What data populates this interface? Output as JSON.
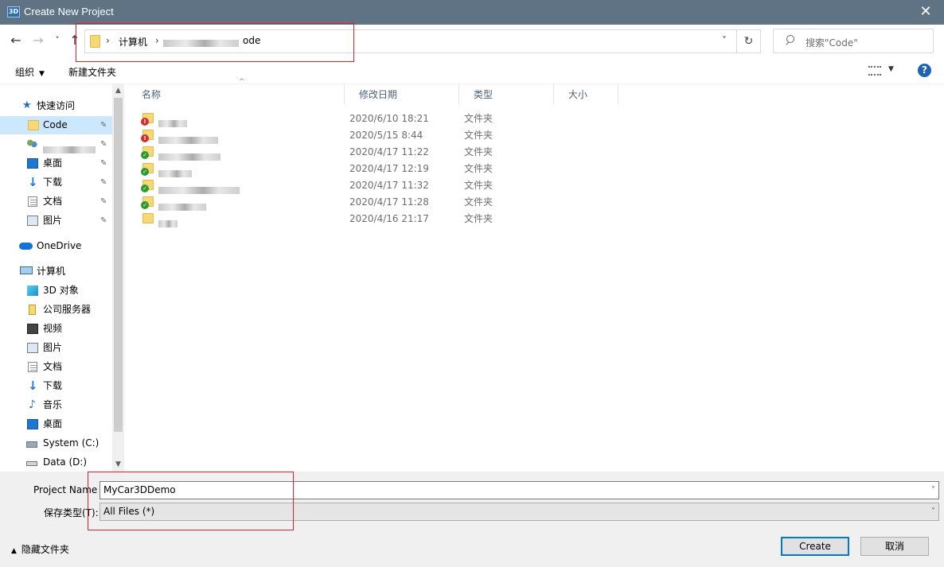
{
  "window": {
    "title": "Create New Project",
    "app_icon_text": "3D",
    "close_glyph": "✕"
  },
  "nav": {
    "back_glyph": "←",
    "forward_glyph": "→",
    "recent_glyph": "˅",
    "up_glyph": "↑"
  },
  "address": {
    "crumb_computer": "计算机",
    "crumb_last_visible": "ode",
    "separator": "›",
    "dropdown_glyph": "˅",
    "refresh_glyph": "↻"
  },
  "search": {
    "placeholder": "搜索\"Code\""
  },
  "toolbar": {
    "organize_label": "组织",
    "organize_caret": "▼",
    "new_folder_label": "新建文件夹",
    "view_caret": "▼",
    "help_label": "?"
  },
  "sidebar": {
    "quick_access": "快速访问",
    "items": [
      {
        "label": "Code",
        "pinned": true,
        "icon": "folder-icon"
      },
      {
        "label": "",
        "pinned": true,
        "icon": "users-icon"
      },
      {
        "label": "桌面",
        "pinned": true,
        "icon": "desktop-icon"
      },
      {
        "label": "下载",
        "pinned": true,
        "icon": "download-icon"
      },
      {
        "label": "文档",
        "pinned": true,
        "icon": "document-icon"
      },
      {
        "label": "图片",
        "pinned": true,
        "icon": "pictures-icon"
      }
    ],
    "onedrive": "OneDrive",
    "computer": "计算机",
    "computer_items": [
      {
        "label": "3D 对象",
        "icon": "3d-objects-icon"
      },
      {
        "label": "公司服务器",
        "icon": "server-icon"
      },
      {
        "label": "视频",
        "icon": "video-icon"
      },
      {
        "label": "图片",
        "icon": "pictures-icon"
      },
      {
        "label": "文档",
        "icon": "document-icon"
      },
      {
        "label": "下载",
        "icon": "download-icon"
      },
      {
        "label": "音乐",
        "icon": "music-icon"
      },
      {
        "label": "桌面",
        "icon": "desktop-icon"
      },
      {
        "label": "System (C:)",
        "icon": "system-drive-icon"
      },
      {
        "label": "Data (D:)",
        "icon": "data-drive-icon"
      }
    ],
    "pin_glyph": "📌",
    "scroll_up": "▲",
    "scroll_down": "▼"
  },
  "filelist": {
    "columns": [
      "名称",
      "修改日期",
      "类型",
      "大小"
    ],
    "sort_glyph": "^",
    "rows": [
      {
        "name": "",
        "date": "2020/6/10 18:21",
        "type": "文件夹",
        "status": "error"
      },
      {
        "name": "",
        "date": "2020/5/15 8:44",
        "type": "文件夹",
        "status": "error"
      },
      {
        "name": "",
        "date": "2020/4/17 11:22",
        "type": "文件夹",
        "status": "ok"
      },
      {
        "name": "",
        "date": "2020/4/17 12:19",
        "type": "文件夹",
        "status": "ok"
      },
      {
        "name": "",
        "date": "2020/4/17 11:32",
        "type": "文件夹",
        "status": "ok"
      },
      {
        "name": "",
        "date": "2020/4/17 11:28",
        "type": "文件夹",
        "status": "ok"
      },
      {
        "name": "",
        "date": "2020/4/16 21:17",
        "type": "文件夹",
        "status": "none"
      }
    ]
  },
  "form": {
    "project_name_label": "Project Name",
    "project_name_value": "MyCar3DDemo",
    "save_type_label": "保存类型(T):",
    "save_type_value": "All Files  (*)",
    "dropdown_glyph": "˅"
  },
  "footer": {
    "hide_folders_label": "隐藏文件夹",
    "hide_caret": "▲",
    "create_label": "Create",
    "cancel_label": "取消"
  },
  "colors": {
    "titlebar": "#5f7385",
    "selection": "#cce8ff",
    "highlight_box": "#e0202e",
    "default_button_border": "#0078d7"
  }
}
